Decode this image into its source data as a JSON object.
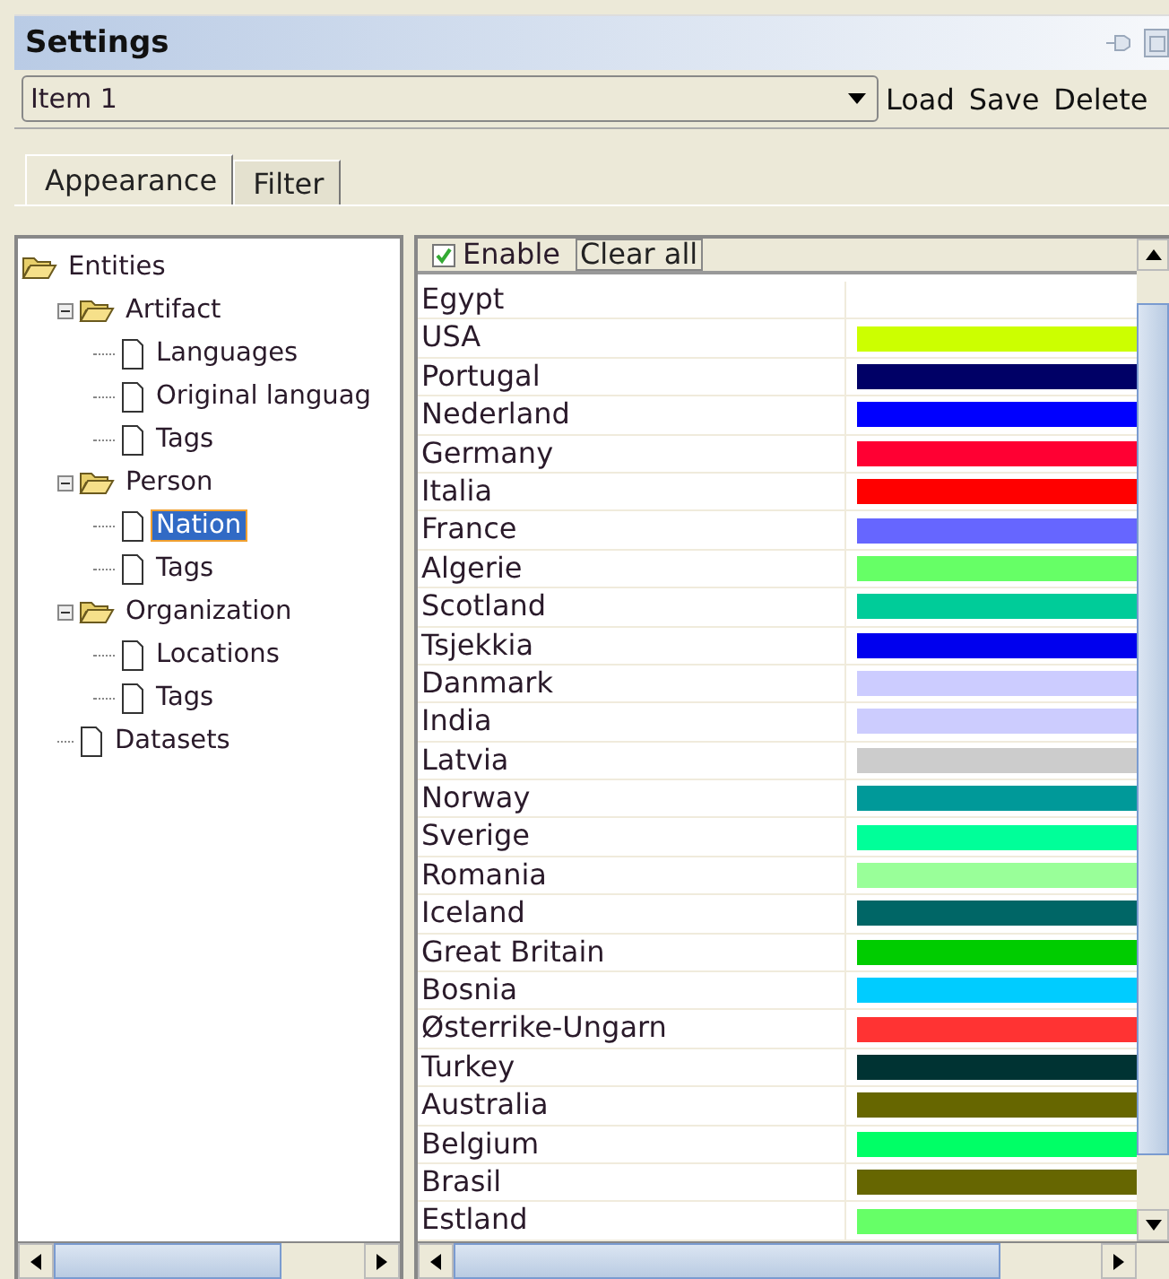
{
  "window": {
    "title": "Settings"
  },
  "preset": {
    "value": "Item 1"
  },
  "buttons": [
    "Load",
    "Save",
    "Delete"
  ],
  "tabs": [
    {
      "label": "Appearance",
      "selected": true
    },
    {
      "label": "Filter",
      "selected": false
    }
  ],
  "tree": [
    {
      "label": "Entities",
      "kind": "folder",
      "expanded": true,
      "selected": false,
      "children": [
        {
          "label": "Artifact",
          "kind": "folder",
          "expanded": true,
          "selected": false,
          "children": [
            {
              "label": "Languages",
              "kind": "file",
              "selected": false
            },
            {
              "label": "Original languag",
              "kind": "file",
              "selected": false
            },
            {
              "label": "Tags",
              "kind": "file",
              "selected": false
            }
          ]
        },
        {
          "label": "Person",
          "kind": "folder",
          "expanded": true,
          "selected": false,
          "children": [
            {
              "label": "Nation",
              "kind": "file",
              "selected": true
            },
            {
              "label": "Tags",
              "kind": "file",
              "selected": false
            }
          ]
        },
        {
          "label": "Organization",
          "kind": "folder",
          "expanded": true,
          "selected": false,
          "children": [
            {
              "label": "Locations",
              "kind": "file",
              "selected": false
            },
            {
              "label": "Tags",
              "kind": "file",
              "selected": false
            }
          ]
        },
        {
          "label": "Datasets",
          "kind": "file",
          "selected": false
        }
      ]
    }
  ],
  "toolbar": {
    "enable": {
      "label": "Enable",
      "checked": true
    },
    "clear_button": "Clear all"
  },
  "rows": [
    {
      "name": "Egypt"
    },
    {
      "name": "USA",
      "color": "#ccff00"
    },
    {
      "name": "Portugal",
      "color": "#000066"
    },
    {
      "name": "Nederland",
      "color": "#0000ff"
    },
    {
      "name": "Germany",
      "color": "#ff0033"
    },
    {
      "name": "Italia",
      "color": "#ff0000"
    },
    {
      "name": "France",
      "color": "#6666ff"
    },
    {
      "name": "Algerie",
      "color": "#66ff66"
    },
    {
      "name": "Scotland",
      "color": "#00cc99"
    },
    {
      "name": "Tsjekkia",
      "color": "#0000ee"
    },
    {
      "name": "Danmark",
      "color": "#ccccff"
    },
    {
      "name": "India",
      "color": "#ccccfe"
    },
    {
      "name": "Latvia",
      "color": "#cccccc"
    },
    {
      "name": "Norway",
      "color": "#009999"
    },
    {
      "name": "Sverige",
      "color": "#00ff99"
    },
    {
      "name": "Romania",
      "color": "#99ff99"
    },
    {
      "name": "Iceland",
      "color": "#006666"
    },
    {
      "name": "Great Britain",
      "color": "#00cc00"
    },
    {
      "name": "Bosnia",
      "color": "#00ccff"
    },
    {
      "name": "Østerrike-Ungarn",
      "color": "#ff3333"
    },
    {
      "name": "Turkey",
      "color": "#003333"
    },
    {
      "name": "Australia",
      "color": "#666600"
    },
    {
      "name": "Belgium",
      "color": "#00ff66"
    },
    {
      "name": "Brasil",
      "color": "#666601"
    },
    {
      "name": "Estland",
      "color": "#66ff67"
    }
  ]
}
